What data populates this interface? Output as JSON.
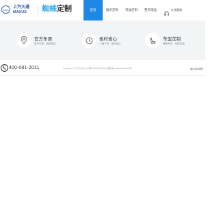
{
  "header": {
    "logo_oval_text": "SAIC",
    "logo_cn": "上汽大通",
    "logo_en": "MAXUS",
    "brand_part1": "蜘蛛",
    "brand_part2": "定制",
    "hotline_label": "在线客服"
  },
  "nav": {
    "items": [
      {
        "label": "首页"
      },
      {
        "label": "服务定制"
      },
      {
        "label": "驾驶定制"
      },
      {
        "label": "整车精品"
      }
    ]
  },
  "features": [
    {
      "title": "官方车源",
      "desc": "官方车源、品质保证"
    },
    {
      "title": "省时省心",
      "desc": "一键下单、省时省心"
    },
    {
      "title": "车型定制",
      "desc": "精准专供、尽量定制"
    }
  ],
  "footer": {
    "phone": "400-081-2011",
    "copyright": "Copyright © 上汽大通 (PK)沪备12000001号 沪公网安备 31011002004313号",
    "link": "图片版本维护"
  },
  "colors": {
    "accent": "#1e88e5",
    "brand_blue": "#3db0e6",
    "logo_blue": "#2a5aa8",
    "band_bg": "#f3f4f6"
  }
}
